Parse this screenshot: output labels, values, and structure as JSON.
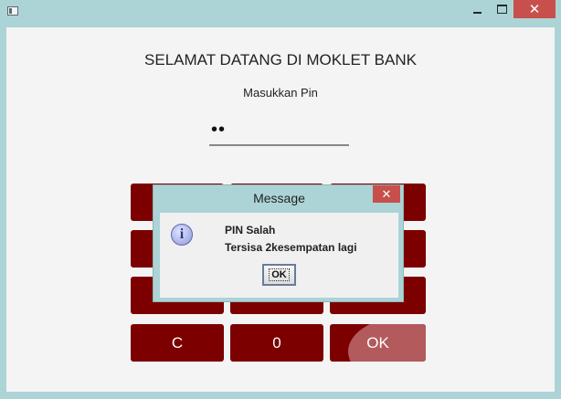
{
  "window": {
    "close_glyph": "✕",
    "icons": {
      "app": "java-window-icon",
      "minimize": "minimize-icon",
      "maximize": "maximize-icon",
      "close": "close-icon"
    }
  },
  "main": {
    "title": "SELAMAT DATANG DI MOKLET BANK",
    "pin_label": "Masukkan Pin",
    "pin_value": "••"
  },
  "keypad": {
    "visible_keys": [
      "C",
      "0",
      "OK"
    ],
    "key_color": "#7c0000",
    "ok_hover_color": "#b35a5d"
  },
  "dialog": {
    "title": "Message",
    "close_glyph": "✕",
    "icon": "info-icon",
    "line1": "PIN Salah",
    "line2": "Tersisa 2kesempatan lagi",
    "ok_label": "OK"
  }
}
